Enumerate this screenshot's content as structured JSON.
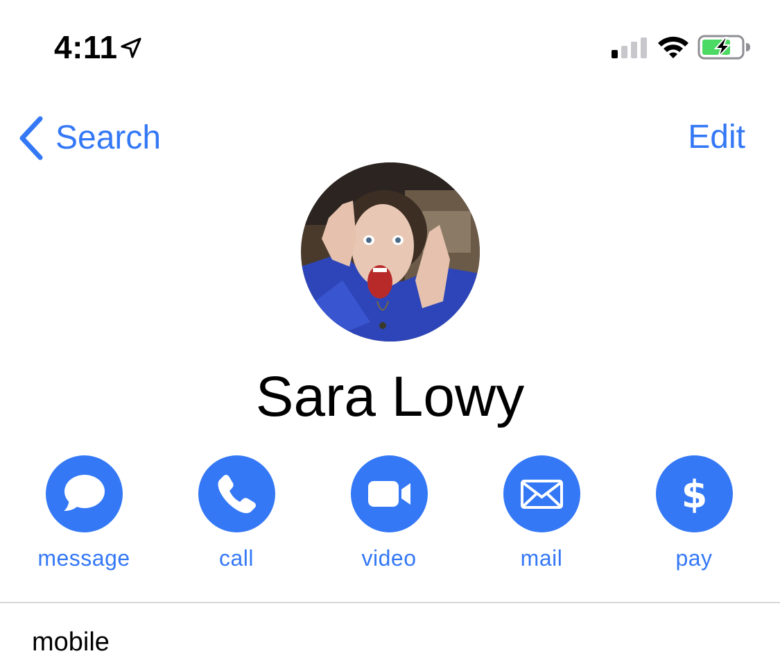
{
  "status_bar": {
    "time": "4:11",
    "location_icon": "location-arrow-icon",
    "signal_icon": "cellular-signal-icon",
    "wifi_icon": "wifi-icon",
    "battery_icon": "battery-charging-icon",
    "signal_bars_active": 1,
    "signal_bars_total": 4
  },
  "nav": {
    "back_label": "Search",
    "edit_label": "Edit"
  },
  "contact": {
    "name": "Sara Lowy"
  },
  "actions": [
    {
      "label": "message",
      "icon": "message-bubble-icon"
    },
    {
      "label": "call",
      "icon": "phone-icon"
    },
    {
      "label": "video",
      "icon": "video-camera-icon"
    },
    {
      "label": "mail",
      "icon": "envelope-icon"
    },
    {
      "label": "pay",
      "icon": "dollar-icon"
    }
  ],
  "fields": {
    "phone_label": "mobile"
  },
  "colors": {
    "accent": "#3478f6",
    "battery_fill": "#4cd964",
    "signal_inactive": "#c7c7cc",
    "divider": "#d8d8dc"
  }
}
